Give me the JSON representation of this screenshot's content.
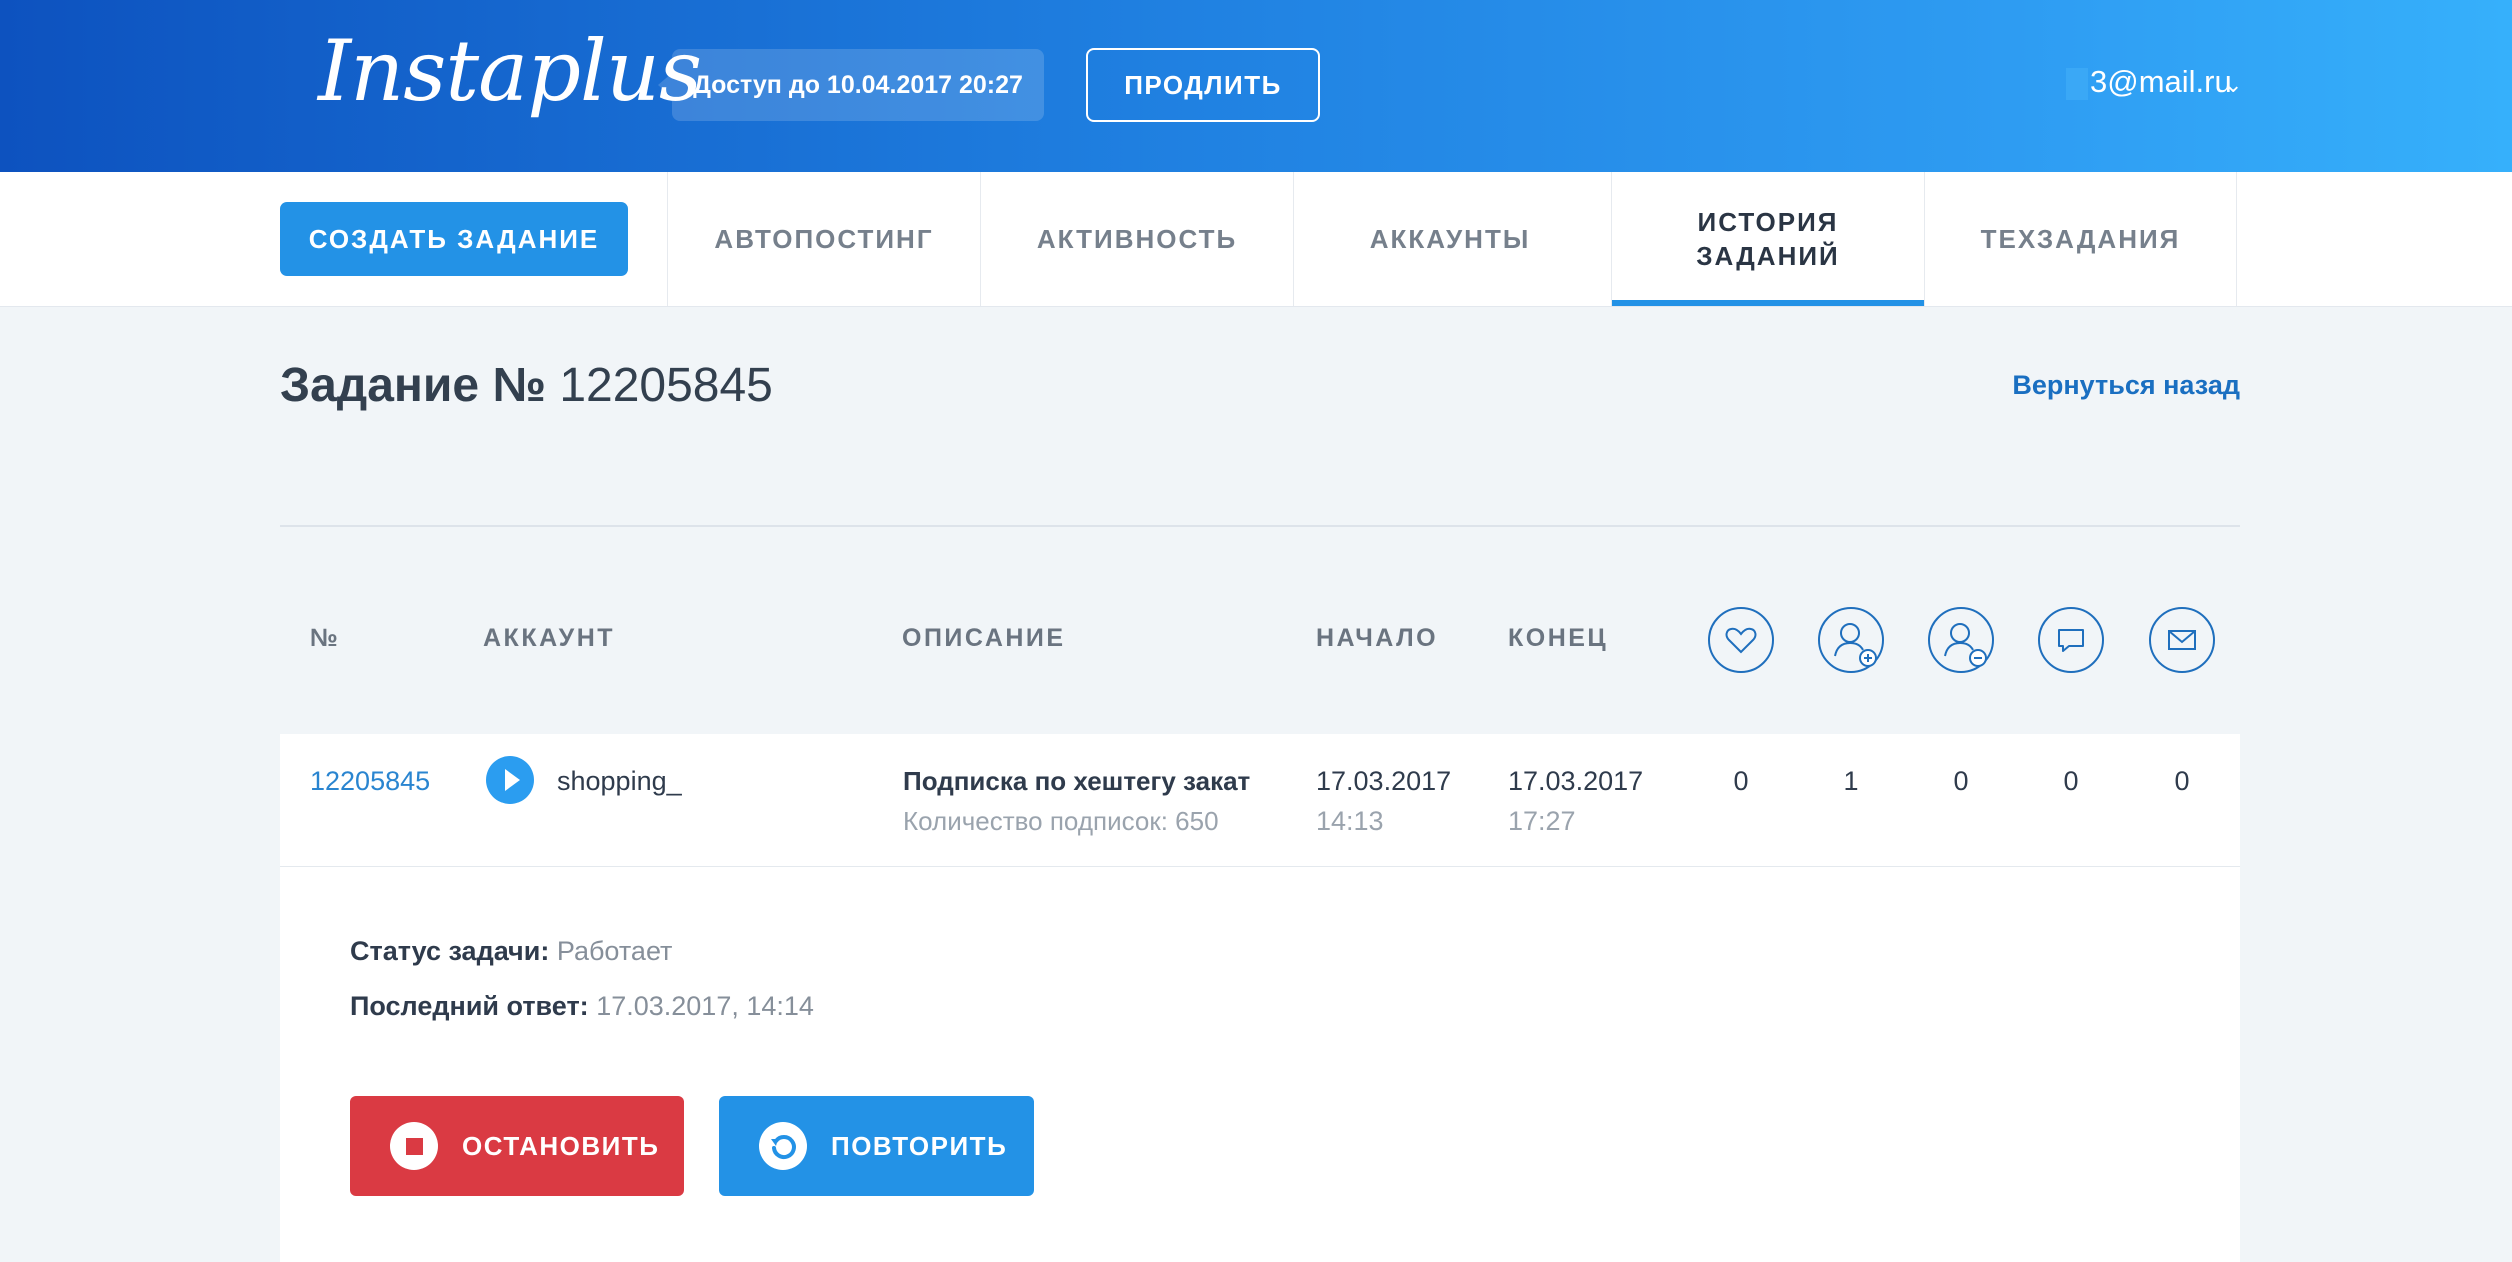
{
  "header": {
    "logo": "Instaplus",
    "access": "Доступ до 10.04.2017 20:27",
    "extend_label": "ПРОДЛИТЬ",
    "user_email": "3@mail.ru"
  },
  "nav": {
    "create_label": "СОЗДАТЬ ЗАДАНИЕ",
    "tabs": [
      {
        "label": "АВТОПОСТИНГ"
      },
      {
        "label": "АКТИВНОСТЬ"
      },
      {
        "label": "АККАУНТЫ"
      },
      {
        "label": "ИСТОРИЯ ЗАДАНИЙ",
        "active": true
      },
      {
        "label": "ТЕХЗАДАНИЯ"
      }
    ]
  },
  "page": {
    "title_prefix": "Задание №",
    "title_number": "12205845",
    "back_link": "Вернуться назад"
  },
  "table": {
    "headers": {
      "num": "№",
      "account": "АККАУНТ",
      "description": "ОПИСАНИЕ",
      "start": "НАЧАЛО",
      "end": "КОНЕЦ"
    },
    "stat_icons": [
      "heart-icon",
      "user-add-icon",
      "user-remove-icon",
      "comment-icon",
      "mail-icon"
    ],
    "row": {
      "id": "12205845",
      "account": "shopping_",
      "description": "Подписка по хештегу закат",
      "description_sub": "Количество подписок: 650",
      "start_date": "17.03.2017",
      "start_time": "14:13",
      "end_date": "17.03.2017",
      "end_time": "17:27",
      "counts": [
        "0",
        "1",
        "0",
        "0",
        "0"
      ]
    }
  },
  "details": {
    "status_label": "Статус задачи:",
    "status_value": "Работает",
    "last_response_label": "Последний ответ:",
    "last_response_value": "17.03.2017, 14:14",
    "stop_label": "ОСТАНОВИТЬ",
    "repeat_label": "ПОВТОРИТЬ"
  },
  "colors": {
    "accent": "#2392e6",
    "danger": "#da3a43",
    "link": "#1a6fc1"
  }
}
